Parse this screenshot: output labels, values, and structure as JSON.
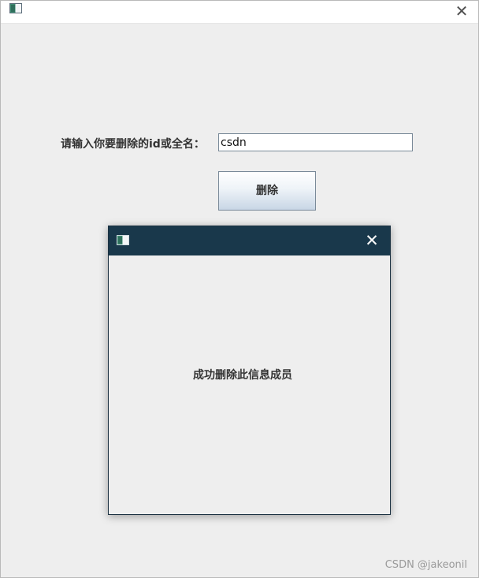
{
  "main_window": {
    "close_glyph": "✕",
    "prompt_label": "请输入你要删除的id或全名：",
    "input_value": "csdn",
    "delete_button_label": "删除"
  },
  "dialog": {
    "close_glyph": "✕",
    "message": "成功删除此信息成员"
  },
  "watermark": "CSDN @jakeonil",
  "icons": {
    "window_icon": "java-app-icon",
    "close_icon": "close-icon"
  },
  "colors": {
    "dialog_titlebar": "#19384b",
    "window_background": "#eeeeee",
    "button_gradient_bottom": "#c8d6e5"
  }
}
